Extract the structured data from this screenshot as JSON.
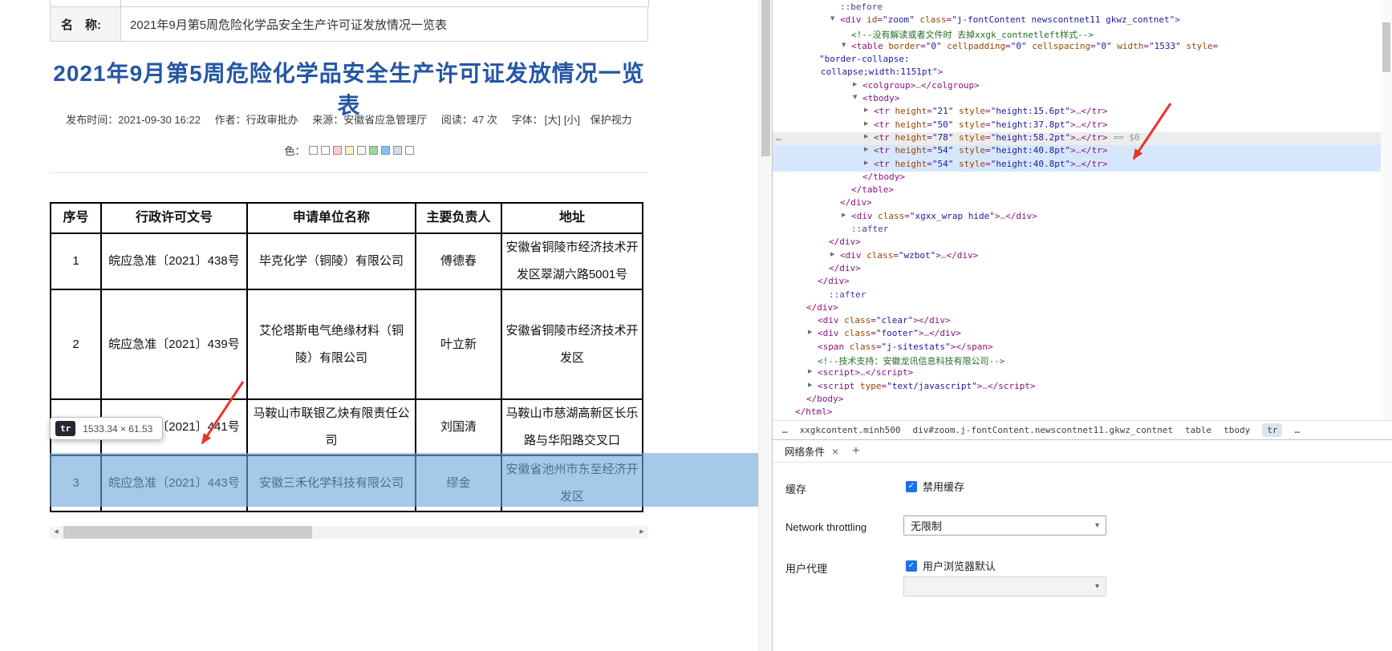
{
  "page": {
    "form_row": {
      "label": "名　称:",
      "value": "2021年9月第5周危险化学品安全生产许可证发放情况一览表"
    },
    "title": "2021年9月第5周危险化学品安全生产许可证发放情况一览表",
    "meta": {
      "published": "发布时间：2021-09-30 16:22",
      "author": "作者：行政审批办",
      "source": "来源：安徽省应急管理厅",
      "reads": "阅读：47 次",
      "font_label": "字体：",
      "font_large": "[大]",
      "font_small": "[小]",
      "eye_protect": "保护视力",
      "color_label": "色：",
      "swatches": [
        "#ffffff",
        "#fdfdfd",
        "#f8cfc4",
        "#f8f3c0",
        "#f3faf0",
        "#9fd89f",
        "#7cc4ee",
        "#d8d8ee",
        "#ffffff"
      ]
    },
    "table": {
      "headers": [
        "序号",
        "行政许可文号",
        "申请单位名称",
        "主要负责人",
        "地址"
      ],
      "rows": [
        [
          "1",
          "皖应急准〔2021〕438号",
          "毕克化学（铜陵）有限公司",
          "傅德春",
          "安徽省铜陵市经济技术开发区翠湖六路5001号"
        ],
        [
          "2",
          "皖应急准〔2021〕439号",
          "艾伦塔斯电气绝缘材料（铜陵）有限公司",
          "叶立新",
          "安徽省铜陵市经济技术开发区"
        ],
        [
          "",
          "皖应急准〔2021〕441号",
          "马鞍山市联银乙炔有限责任公司",
          "刘国清",
          "马鞍山市慈湖高新区长乐路与华阳路交叉口"
        ],
        [
          "3",
          "皖应急准〔2021〕443号",
          "安徽三禾化学科技有限公司",
          "缪金",
          "安徽省池州市东至经济开发区"
        ]
      ]
    },
    "tooltip": {
      "tag": "tr",
      "size": "1533.34 × 61.53"
    }
  },
  "icons": {
    "scroll_left": "◀",
    "scroll_right": "▶",
    "expanded": "▼",
    "collapsed": "▶",
    "check": "✓",
    "select_chevron": "▾",
    "close": "×",
    "add": "+",
    "ellipsis": "…"
  },
  "devtools": {
    "gutter": "…",
    "tree": [
      {
        "i": 84,
        "t": [
          [
            "::before",
            "ps"
          ]
        ]
      },
      {
        "i": 84,
        "a": "d",
        "t": [
          [
            "<div ",
            "p"
          ],
          [
            "id",
            "a"
          ],
          [
            "=",
            "p"
          ],
          [
            "\"zoom\"",
            "v"
          ],
          [
            " ",
            "t"
          ],
          [
            "class",
            "a"
          ],
          [
            "=",
            "p"
          ],
          [
            "\"j-fontContent newscontnet11 gkwz_contnet\"",
            "v"
          ],
          [
            ">",
            "p"
          ]
        ]
      },
      {
        "i": 98,
        "t": [
          [
            "<!--没有解读或者文件时 去掉xxgk_contnetleft样式-->",
            "c"
          ]
        ]
      },
      {
        "i": 98,
        "a": "d",
        "t": [
          [
            "<table ",
            "p"
          ],
          [
            "border",
            "a"
          ],
          [
            "=",
            "p"
          ],
          [
            "\"0\"",
            "v"
          ],
          [
            " ",
            "t"
          ],
          [
            "cellpadding",
            "a"
          ],
          [
            "=",
            "p"
          ],
          [
            "\"0\"",
            "v"
          ],
          [
            " ",
            "t"
          ],
          [
            "cellspacing",
            "a"
          ],
          [
            "=",
            "p"
          ],
          [
            "\"0\"",
            "v"
          ],
          [
            " ",
            "t"
          ],
          [
            "width",
            "a"
          ],
          [
            "=",
            "p"
          ],
          [
            "\"1533\"",
            "v"
          ],
          [
            " ",
            "t"
          ],
          [
            "style",
            "a"
          ],
          [
            "=",
            "p"
          ]
        ]
      },
      {
        "i": 58,
        "t": [
          [
            "\"border-collapse:",
            "v"
          ]
        ]
      },
      {
        "i": 60,
        "t": [
          [
            "collapse;width:1151pt\"",
            "v"
          ],
          [
            ">",
            "p"
          ]
        ]
      },
      {
        "i": 112,
        "a": "r",
        "t": [
          [
            "<colgroup>",
            "p"
          ],
          [
            "…",
            "e"
          ],
          [
            "</colgroup>",
            "p"
          ]
        ]
      },
      {
        "i": 112,
        "a": "d",
        "t": [
          [
            "<tbody>",
            "p"
          ]
        ]
      },
      {
        "i": 126,
        "a": "r",
        "t": [
          [
            "<tr ",
            "p"
          ],
          [
            "height",
            "a"
          ],
          [
            "=",
            "p"
          ],
          [
            "\"21\"",
            "v"
          ],
          [
            " ",
            "t"
          ],
          [
            "style",
            "a"
          ],
          [
            "=",
            "p"
          ],
          [
            "\"height:15.6pt\"",
            "v"
          ],
          [
            ">",
            "p"
          ],
          [
            "…",
            "e"
          ],
          [
            "</tr>",
            "p"
          ]
        ]
      },
      {
        "i": 126,
        "a": "r",
        "t": [
          [
            "<tr ",
            "p"
          ],
          [
            "height",
            "a"
          ],
          [
            "=",
            "p"
          ],
          [
            "\"50\"",
            "v"
          ],
          [
            " ",
            "t"
          ],
          [
            "style",
            "a"
          ],
          [
            "=",
            "p"
          ],
          [
            "\"height:37.8pt\"",
            "v"
          ],
          [
            ">",
            "p"
          ],
          [
            "…",
            "e"
          ],
          [
            "</tr>",
            "p"
          ]
        ]
      },
      {
        "i": 126,
        "a": "r",
        "bg": "h",
        "g": true,
        "m": "== $0",
        "t": [
          [
            "<tr ",
            "p"
          ],
          [
            "height",
            "a"
          ],
          [
            "=",
            "p"
          ],
          [
            "\"78\"",
            "v"
          ],
          [
            " ",
            "t"
          ],
          [
            "style",
            "a"
          ],
          [
            "=",
            "p"
          ],
          [
            "\"height:58.2pt\"",
            "v"
          ],
          [
            ">",
            "p"
          ],
          [
            "…",
            "e"
          ],
          [
            "</tr>",
            "p"
          ]
        ]
      },
      {
        "i": 126,
        "a": "r",
        "bg": "s",
        "t": [
          [
            "<tr ",
            "p"
          ],
          [
            "height",
            "a"
          ],
          [
            "=",
            "p"
          ],
          [
            "\"54\"",
            "v"
          ],
          [
            " ",
            "t"
          ],
          [
            "style",
            "a"
          ],
          [
            "=",
            "p"
          ],
          [
            "\"height:40.8pt\"",
            "v"
          ],
          [
            ">",
            "p"
          ],
          [
            "…",
            "e"
          ],
          [
            "</tr>",
            "p"
          ]
        ]
      },
      {
        "i": 126,
        "a": "r",
        "bg": "s",
        "t": [
          [
            "<tr ",
            "p"
          ],
          [
            "height",
            "a"
          ],
          [
            "=",
            "p"
          ],
          [
            "\"54\"",
            "v"
          ],
          [
            " ",
            "t"
          ],
          [
            "style",
            "a"
          ],
          [
            "=",
            "p"
          ],
          [
            "\"height:40.8pt\"",
            "v"
          ],
          [
            ">",
            "p"
          ],
          [
            "…",
            "e"
          ],
          [
            "</tr>",
            "p"
          ]
        ]
      },
      {
        "i": 112,
        "t": [
          [
            "</tbody>",
            "p"
          ]
        ]
      },
      {
        "i": 98,
        "t": [
          [
            "</table>",
            "p"
          ]
        ]
      },
      {
        "i": 84,
        "t": [
          [
            "</div>",
            "p"
          ]
        ]
      },
      {
        "i": 98,
        "a": "r",
        "t": [
          [
            "<div ",
            "p"
          ],
          [
            "class",
            "a"
          ],
          [
            "=",
            "p"
          ],
          [
            "\"xgxx_wrap hide\"",
            "v"
          ],
          [
            ">",
            "p"
          ],
          [
            "…",
            "e"
          ],
          [
            "</div>",
            "p"
          ]
        ]
      },
      {
        "i": 98,
        "t": [
          [
            "::after",
            "ps"
          ]
        ]
      },
      {
        "i": 70,
        "t": [
          [
            "</div>",
            "p"
          ]
        ]
      },
      {
        "i": 84,
        "a": "r",
        "t": [
          [
            "<div ",
            "p"
          ],
          [
            "class",
            "a"
          ],
          [
            "=",
            "p"
          ],
          [
            "\"wzbot\"",
            "v"
          ],
          [
            ">",
            "p"
          ],
          [
            "…",
            "e"
          ],
          [
            "</div>",
            "p"
          ]
        ]
      },
      {
        "i": 70,
        "t": [
          [
            "</div>",
            "p"
          ]
        ]
      },
      {
        "i": 56,
        "t": [
          [
            "</div>",
            "p"
          ]
        ]
      },
      {
        "i": 70,
        "t": [
          [
            "::after",
            "ps"
          ]
        ]
      },
      {
        "i": 42,
        "t": [
          [
            "</div>",
            "p"
          ]
        ]
      },
      {
        "i": 56,
        "t": [
          [
            "<div ",
            "p"
          ],
          [
            "class",
            "a"
          ],
          [
            "=",
            "p"
          ],
          [
            "\"clear\"",
            "v"
          ],
          [
            ">",
            "p"
          ],
          [
            "</div>",
            "p"
          ]
        ]
      },
      {
        "i": 56,
        "a": "r",
        "t": [
          [
            "<div ",
            "p"
          ],
          [
            "class",
            "a"
          ],
          [
            "=",
            "p"
          ],
          [
            "\"footer\"",
            "v"
          ],
          [
            ">",
            "p"
          ],
          [
            "…",
            "e"
          ],
          [
            "</div>",
            "p"
          ]
        ]
      },
      {
        "i": 56,
        "t": [
          [
            "<span ",
            "p"
          ],
          [
            "class",
            "a"
          ],
          [
            "=",
            "p"
          ],
          [
            "\"j-sitestats\"",
            "v"
          ],
          [
            ">",
            "p"
          ],
          [
            "</span>",
            "p"
          ]
        ]
      },
      {
        "i": 56,
        "t": [
          [
            "<!--技术支持：安徽龙讯信息科技有限公司-->",
            "c"
          ]
        ]
      },
      {
        "i": 56,
        "a": "r",
        "t": [
          [
            "<script>",
            "p"
          ],
          [
            "…",
            "e"
          ],
          [
            "</script>",
            "p"
          ]
        ]
      },
      {
        "i": 56,
        "a": "r",
        "t": [
          [
            "<script ",
            "p"
          ],
          [
            "type",
            "a"
          ],
          [
            "=",
            "p"
          ],
          [
            "\"text/javascript\"",
            "v"
          ],
          [
            ">",
            "p"
          ],
          [
            "…",
            "e"
          ],
          [
            "</script>",
            "p"
          ]
        ]
      },
      {
        "i": 42,
        "t": [
          [
            "</body>",
            "p"
          ]
        ]
      },
      {
        "i": 28,
        "t": [
          [
            "</html>",
            "p"
          ]
        ]
      }
    ],
    "crumbs": [
      {
        "t": "…",
        "sel": false
      },
      {
        "t": "xxgkcontent.minh500",
        "sel": false
      },
      {
        "t": "div#zoom.j-fontContent.newscontnet11.gkwz_contnet",
        "sel": false
      },
      {
        "t": "table",
        "sel": false
      },
      {
        "t": "tbody",
        "sel": false
      },
      {
        "t": "tr",
        "sel": true
      },
      {
        "t": "…",
        "sel": false
      }
    ],
    "drawer": {
      "tab_label": "网络条件",
      "cache_label": "缓存",
      "cache_option": "禁用缓存",
      "throttle_label": "Network throttling",
      "throttle_value": "无限制",
      "ua_label": "用户代理",
      "ua_option": "用户浏览器默认"
    }
  }
}
